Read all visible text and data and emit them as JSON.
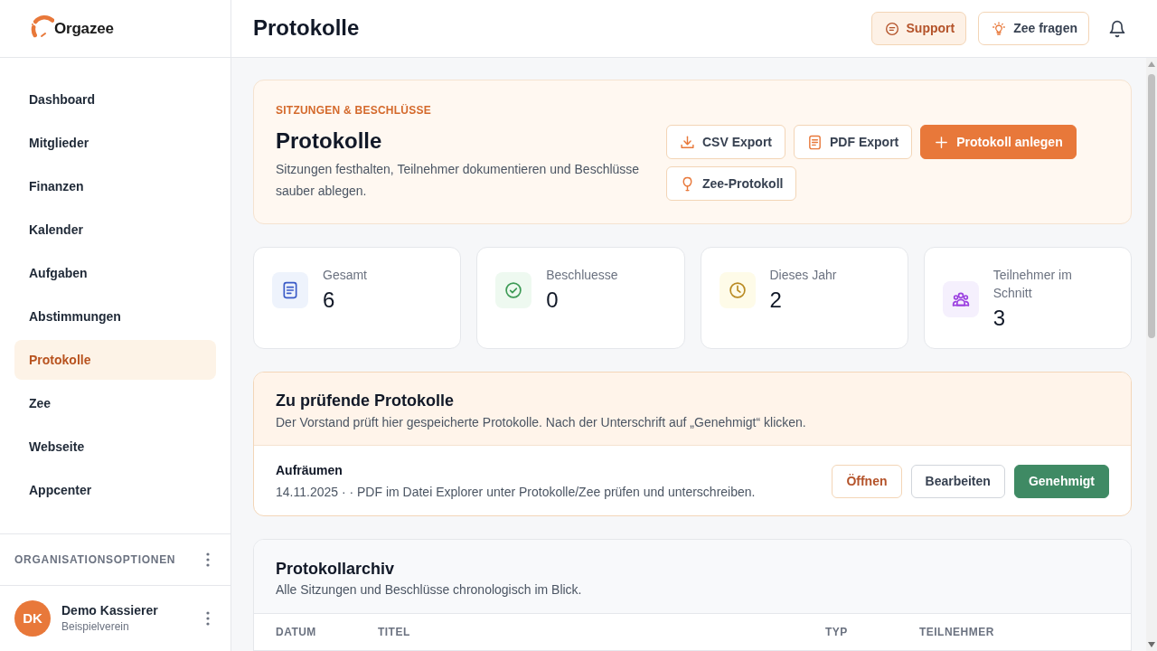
{
  "brand": {
    "name": "Orgazee"
  },
  "sidebar": {
    "items": [
      {
        "label": "Dashboard",
        "selected": false
      },
      {
        "label": "Mitglieder",
        "selected": false
      },
      {
        "label": "Finanzen",
        "selected": false
      },
      {
        "label": "Kalender",
        "selected": false
      },
      {
        "label": "Aufgaben",
        "selected": false
      },
      {
        "label": "Abstimmungen",
        "selected": false
      },
      {
        "label": "Protokolle",
        "selected": true
      },
      {
        "label": "Zee",
        "selected": false
      },
      {
        "label": "Webseite",
        "selected": false
      },
      {
        "label": "Appcenter",
        "selected": false
      }
    ],
    "options_label": "ORGANISATIONSOPTIONEN",
    "user": {
      "initials": "DK",
      "name": "Demo Kassierer",
      "organization": "Beispielverein"
    }
  },
  "header": {
    "title": "Protokolle",
    "buttons": [
      {
        "label": "Support",
        "kind": "support"
      },
      {
        "label": "Zee fragen",
        "kind": "assistant"
      }
    ]
  },
  "hero": {
    "eyebrow": "SITZUNGEN & BESCHLÜSSE",
    "title": "Protokolle",
    "description": "Sitzungen festhalten, Teilnehmer dokumentieren und Beschlüsse sauber ablegen.",
    "actions": [
      {
        "label": "CSV Export",
        "kind": "csv"
      },
      {
        "label": "PDF Export",
        "kind": "pdf"
      },
      {
        "label": "Protokoll anlegen",
        "kind": "create"
      },
      {
        "label": "Zee-Protokoll",
        "kind": "assistant"
      }
    ]
  },
  "stats": [
    {
      "label": "Gesamt",
      "value": "6",
      "kind": "total"
    },
    {
      "label": "Beschluesse",
      "value": "0",
      "kind": "decisions"
    },
    {
      "label": "Dieses Jahr",
      "value": "2",
      "kind": "year"
    },
    {
      "label": "Teilnehmer im Schnitt",
      "value": "3",
      "kind": "participants"
    }
  ],
  "review": {
    "title": "Zu prüfende Protokolle",
    "subtitle": "Der Vorstand prüft hier gespeicherte Protokolle. Nach der Unterschrift auf „Genehmigt“ klicken.",
    "items": [
      {
        "title": "Aufräumen",
        "meta": "14.11.2025 · · PDF im Datei Explorer unter Protokolle/Zee prüfen und unterschreiben.",
        "actions": [
          {
            "label": "Öffnen",
            "kind": "open"
          },
          {
            "label": "Bearbeiten",
            "kind": "edit"
          },
          {
            "label": "Genehmigt",
            "kind": "approve"
          }
        ]
      }
    ]
  },
  "archive": {
    "title": "Protokollarchiv",
    "subtitle": "Alle Sitzungen und Beschlüsse chronologisch im Blick.",
    "table": {
      "columns": [
        "DATUM",
        "TITEL",
        "TYP",
        "TEILNEHMER"
      ]
    }
  }
}
